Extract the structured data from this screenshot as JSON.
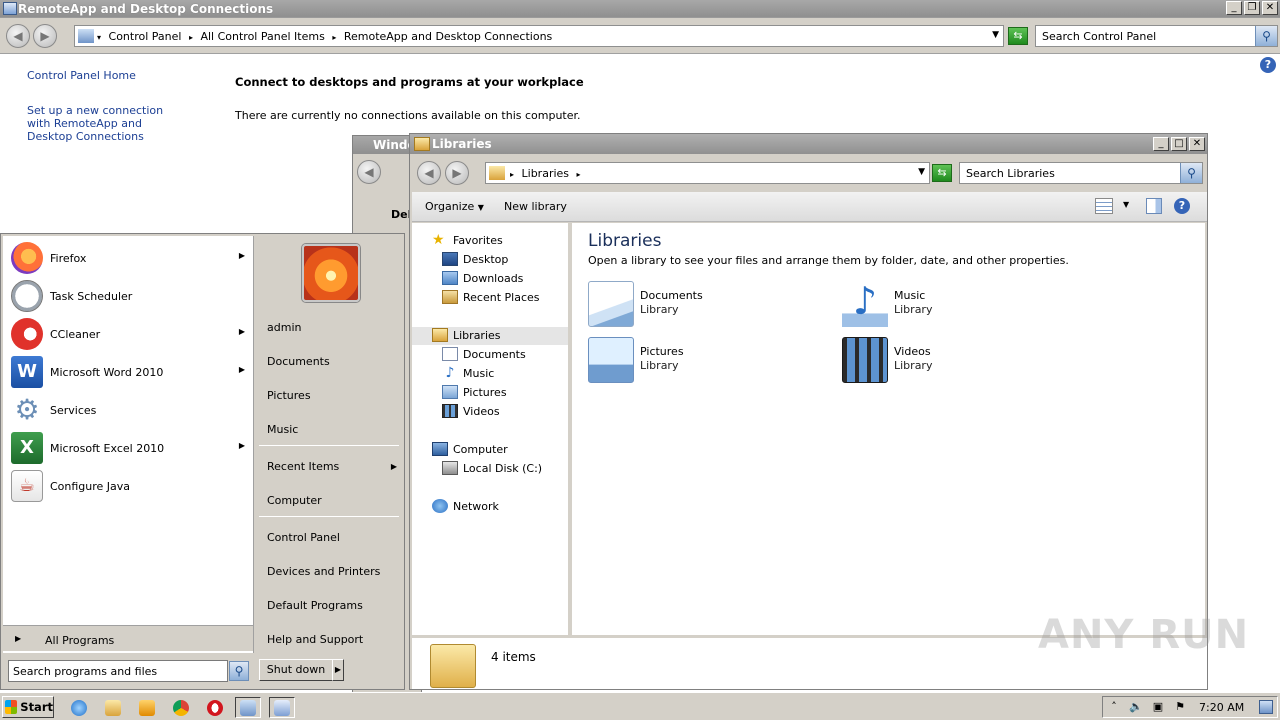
{
  "cp": {
    "title": "RemoteApp and Desktop Connections",
    "breadcrumbs": [
      "Control Panel",
      "All Control Panel Items",
      "RemoteApp and Desktop Connections"
    ],
    "search_placeholder": "Search Control Panel",
    "home_link": "Control Panel Home",
    "setup_link": "Set up a new connection with RemoteApp and Desktop Connections",
    "heading": "Connect to desktops and programs at your workplace",
    "message": "There are currently no connections available on this computer."
  },
  "wnd2": {
    "title": "Windo",
    "body": "Del"
  },
  "lib": {
    "title": "Libraries",
    "breadcrumb": "Libraries",
    "search_placeholder": "Search Libraries",
    "toolbar": {
      "organize": "Organize",
      "new_library": "New library"
    },
    "nav": {
      "favorites": "Favorites",
      "desktop": "Desktop",
      "downloads": "Downloads",
      "recent": "Recent Places",
      "libraries": "Libraries",
      "documents": "Documents",
      "music": "Music",
      "pictures": "Pictures",
      "videos": "Videos",
      "computer": "Computer",
      "local_disk": "Local Disk (C:)",
      "network": "Network"
    },
    "heading": "Libraries",
    "subtitle": "Open a library to see your files and arrange them by folder, date, and other properties.",
    "tiles": [
      {
        "name": "Documents",
        "kind": "Library"
      },
      {
        "name": "Music",
        "kind": "Library"
      },
      {
        "name": "Pictures",
        "kind": "Library"
      },
      {
        "name": "Videos",
        "kind": "Library"
      }
    ],
    "count": "4 items"
  },
  "start_menu": {
    "programs": [
      {
        "label": "Firefox"
      },
      {
        "label": "Task Scheduler"
      },
      {
        "label": "CCleaner"
      },
      {
        "label": "Microsoft Word 2010"
      },
      {
        "label": "Services"
      },
      {
        "label": "Microsoft Excel 2010"
      },
      {
        "label": "Configure Java"
      }
    ],
    "all_programs": "All Programs",
    "search_placeholder": "Search programs and files",
    "right": {
      "user": "admin",
      "documents": "Documents",
      "pictures": "Pictures",
      "music": "Music",
      "recent": "Recent Items",
      "computer": "Computer",
      "control_panel": "Control Panel",
      "devices": "Devices and Printers",
      "defaults": "Default Programs",
      "help": "Help and Support"
    },
    "shutdown": "Shut down"
  },
  "taskbar": {
    "start": "Start",
    "clock": "7:20 AM"
  },
  "watermark": "ANY RUN"
}
